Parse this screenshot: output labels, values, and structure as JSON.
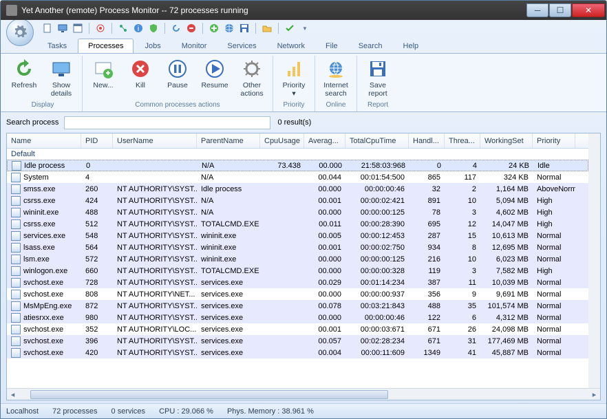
{
  "window": {
    "title": "Yet Another (remote) Process Monitor -- 72 processes running"
  },
  "tabs": [
    "Tasks",
    "Processes",
    "Jobs",
    "Monitor",
    "Services",
    "Network",
    "File",
    "Search",
    "Help"
  ],
  "activeTab": 1,
  "ribbon": {
    "groups": [
      {
        "caption": "Display",
        "buttons": [
          {
            "id": "refresh",
            "label": "Refresh"
          },
          {
            "id": "details",
            "label": "Show\ndetails"
          }
        ]
      },
      {
        "caption": "Common processes actions",
        "buttons": [
          {
            "id": "new",
            "label": "New..."
          },
          {
            "id": "kill",
            "label": "Kill"
          },
          {
            "id": "pause",
            "label": "Pause"
          },
          {
            "id": "resume",
            "label": "Resume"
          },
          {
            "id": "other",
            "label": "Other\nactions"
          }
        ]
      },
      {
        "caption": "Priority",
        "buttons": [
          {
            "id": "priority",
            "label": "Priority\n▾"
          }
        ]
      },
      {
        "caption": "Online",
        "buttons": [
          {
            "id": "isearch",
            "label": "Internet\nsearch"
          }
        ]
      },
      {
        "caption": "Report",
        "buttons": [
          {
            "id": "save",
            "label": "Save\nreport"
          }
        ]
      }
    ]
  },
  "search": {
    "label": "Search process",
    "value": "",
    "result": "0 result(s)"
  },
  "columns": [
    {
      "key": "name",
      "label": "Name",
      "cls": "c-name"
    },
    {
      "key": "pid",
      "label": "PID",
      "cls": "c-pid"
    },
    {
      "key": "user",
      "label": "UserName",
      "cls": "c-user"
    },
    {
      "key": "parent",
      "label": "ParentName",
      "cls": "c-parent"
    },
    {
      "key": "cpuu",
      "label": "CpuUsage",
      "cls": "c-cpuu",
      "r": 1
    },
    {
      "key": "avg",
      "label": "Averag...",
      "cls": "c-avg",
      "r": 1
    },
    {
      "key": "tct",
      "label": "TotalCpuTime",
      "cls": "c-tct",
      "r": 1
    },
    {
      "key": "handl",
      "label": "Handl...",
      "cls": "c-handl",
      "r": 1
    },
    {
      "key": "thr",
      "label": "Threa...",
      "cls": "c-thr",
      "r": 1
    },
    {
      "key": "ws",
      "label": "WorkingSet",
      "cls": "c-ws",
      "r": 1
    },
    {
      "key": "prio",
      "label": "Priority",
      "cls": "c-prio"
    }
  ],
  "groupLabel": "Default",
  "rows": [
    {
      "hl": 1,
      "name": "Idle process",
      "pid": "0",
      "user": "",
      "parent": "N/A",
      "cpuu": "73.438",
      "avg": "00.000",
      "tct": "21:58:03:968",
      "handl": "0",
      "thr": "4",
      "ws": "24 KB",
      "prio": "Idle"
    },
    {
      "plain": 1,
      "name": "System",
      "pid": "4",
      "user": "",
      "parent": "N/A",
      "cpuu": "",
      "avg": "00.044",
      "tct": "00:01:54:500",
      "handl": "865",
      "thr": "117",
      "ws": "324 KB",
      "prio": "Normal"
    },
    {
      "name": "smss.exe",
      "pid": "260",
      "user": "NT AUTHORITY\\SYST...",
      "parent": "Idle process",
      "cpuu": "",
      "avg": "00.000",
      "tct": "00:00:00:46",
      "handl": "32",
      "thr": "2",
      "ws": "1,164 MB",
      "prio": "AboveNorm"
    },
    {
      "name": "csrss.exe",
      "pid": "424",
      "user": "NT AUTHORITY\\SYST...",
      "parent": "N/A",
      "cpuu": "",
      "avg": "00.001",
      "tct": "00:00:02:421",
      "handl": "891",
      "thr": "10",
      "ws": "5,094 MB",
      "prio": "High"
    },
    {
      "name": "wininit.exe",
      "pid": "488",
      "user": "NT AUTHORITY\\SYST...",
      "parent": "N/A",
      "cpuu": "",
      "avg": "00.000",
      "tct": "00:00:00:125",
      "handl": "78",
      "thr": "3",
      "ws": "4,602 MB",
      "prio": "High"
    },
    {
      "name": "csrss.exe",
      "pid": "512",
      "user": "NT AUTHORITY\\SYST...",
      "parent": "TOTALCMD.EXE",
      "cpuu": "",
      "avg": "00.011",
      "tct": "00:00:28:390",
      "handl": "695",
      "thr": "12",
      "ws": "14,047 MB",
      "prio": "High"
    },
    {
      "name": "services.exe",
      "pid": "548",
      "user": "NT AUTHORITY\\SYST...",
      "parent": "wininit.exe",
      "cpuu": "",
      "avg": "00.005",
      "tct": "00:00:12:453",
      "handl": "287",
      "thr": "15",
      "ws": "10,613 MB",
      "prio": "Normal"
    },
    {
      "name": "lsass.exe",
      "pid": "564",
      "user": "NT AUTHORITY\\SYST...",
      "parent": "wininit.exe",
      "cpuu": "",
      "avg": "00.001",
      "tct": "00:00:02:750",
      "handl": "934",
      "thr": "8",
      "ws": "12,695 MB",
      "prio": "Normal"
    },
    {
      "name": "lsm.exe",
      "pid": "572",
      "user": "NT AUTHORITY\\SYST...",
      "parent": "wininit.exe",
      "cpuu": "",
      "avg": "00.000",
      "tct": "00:00:00:125",
      "handl": "216",
      "thr": "10",
      "ws": "6,023 MB",
      "prio": "Normal"
    },
    {
      "name": "winlogon.exe",
      "pid": "660",
      "user": "NT AUTHORITY\\SYST...",
      "parent": "TOTALCMD.EXE",
      "cpuu": "",
      "avg": "00.000",
      "tct": "00:00:00:328",
      "handl": "119",
      "thr": "3",
      "ws": "7,582 MB",
      "prio": "High"
    },
    {
      "name": "svchost.exe",
      "pid": "728",
      "user": "NT AUTHORITY\\SYST...",
      "parent": "services.exe",
      "cpuu": "",
      "avg": "00.029",
      "tct": "00:01:14:234",
      "handl": "387",
      "thr": "11",
      "ws": "10,039 MB",
      "prio": "Normal"
    },
    {
      "plain": 1,
      "name": "svchost.exe",
      "pid": "808",
      "user": "NT AUTHORITY\\NET...",
      "parent": "services.exe",
      "cpuu": "",
      "avg": "00.000",
      "tct": "00:00:00:937",
      "handl": "356",
      "thr": "9",
      "ws": "9,691 MB",
      "prio": "Normal"
    },
    {
      "name": "MsMpEng.exe",
      "pid": "872",
      "user": "NT AUTHORITY\\SYST...",
      "parent": "services.exe",
      "cpuu": "",
      "avg": "00.078",
      "tct": "00:03:21:843",
      "handl": "488",
      "thr": "35",
      "ws": "101,574 MB",
      "prio": "Normal"
    },
    {
      "name": "atiesrxx.exe",
      "pid": "980",
      "user": "NT AUTHORITY\\SYST...",
      "parent": "services.exe",
      "cpuu": "",
      "avg": "00.000",
      "tct": "00:00:00:46",
      "handl": "122",
      "thr": "6",
      "ws": "4,312 MB",
      "prio": "Normal"
    },
    {
      "plain": 1,
      "name": "svchost.exe",
      "pid": "352",
      "user": "NT AUTHORITY\\LOC...",
      "parent": "services.exe",
      "cpuu": "",
      "avg": "00.001",
      "tct": "00:00:03:671",
      "handl": "671",
      "thr": "26",
      "ws": "24,098 MB",
      "prio": "Normal"
    },
    {
      "name": "svchost.exe",
      "pid": "396",
      "user": "NT AUTHORITY\\SYST...",
      "parent": "services.exe",
      "cpuu": "",
      "avg": "00.057",
      "tct": "00:02:28:234",
      "handl": "671",
      "thr": "31",
      "ws": "177,469 MB",
      "prio": "Normal"
    },
    {
      "name": "svchost.exe",
      "pid": "420",
      "user": "NT AUTHORITY\\SYST...",
      "parent": "services.exe",
      "cpuu": "",
      "avg": "00.004",
      "tct": "00:00:11:609",
      "handl": "1349",
      "thr": "41",
      "ws": "45,887 MB",
      "prio": "Normal"
    }
  ],
  "status": {
    "host": "Localhost",
    "procs": "72 processes",
    "svcs": "0 services",
    "cpu": "CPU : 29.066 %",
    "mem": "Phys. Memory : 38.961 %"
  }
}
